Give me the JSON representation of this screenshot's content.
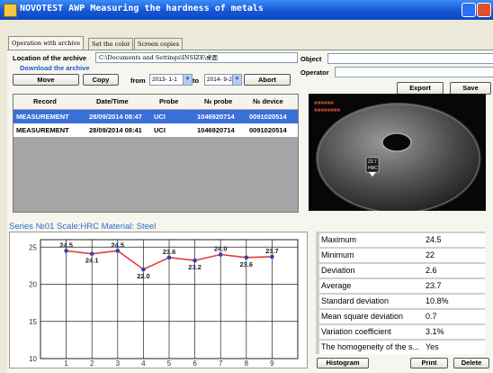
{
  "window": {
    "title": "NOVOTEST AWP Measuring the hardness of metals",
    "colors": {
      "titlebar": "#1457d6",
      "selection": "#3b6fd8",
      "series_label": "#2f6ec8",
      "chart_line": "#e23b3b",
      "chart_point": "#2446b5"
    }
  },
  "tabs": [
    {
      "label": "Operation with archive",
      "active": true
    },
    {
      "label": "Set the color",
      "active": false
    },
    {
      "label": "Screen copies",
      "active": false
    }
  ],
  "archive": {
    "location_label": "Location of the archive",
    "location_value": "C:\\Documents and Settings\\INSIZE\\桌面",
    "download_link": "Download the archive",
    "move_button": "Move",
    "copy_button": "Copy",
    "from_label": "from",
    "from_value": "2013- 1-1",
    "to_label": "to",
    "to_value": "2014- 9-2",
    "abort_button": "Abort"
  },
  "object": {
    "object_label": "Object",
    "object_value": "",
    "operator_label": "Operator",
    "operator_value": "",
    "export_button": "Export",
    "save_button": "Save"
  },
  "table": {
    "columns": [
      "Record",
      "Date/Time",
      "Probe",
      "№ probe",
      "№ device"
    ],
    "rows": [
      {
        "record": "MEASUREMENT",
        "datetime": "28/09/2014 08:47",
        "probe": "UCI",
        "probe_no": "1046920714",
        "device_no": "0091020514",
        "selected": true
      },
      {
        "record": "MEASUREMENT",
        "datetime": "28/09/2014 08:41",
        "probe": "UCI",
        "probe_no": "1046920714",
        "device_no": "0091020514",
        "selected": false
      }
    ]
  },
  "image": {
    "indicator_label": "23.7\nHRC"
  },
  "series_label": "Series №01 Scale:HRC Material: Steel",
  "chart_data": {
    "type": "line",
    "x": [
      1,
      2,
      3,
      4,
      5,
      6,
      7,
      8,
      9
    ],
    "values": [
      24.5,
      24.1,
      24.5,
      22.0,
      23.6,
      23.2,
      24.0,
      23.6,
      23.7
    ],
    "data_labels": [
      "24.5",
      "24.1",
      "24.5",
      "22.0",
      "23.6",
      "23.2",
      "24.0",
      "23.6",
      "23.7"
    ],
    "xticks": [
      "1",
      "2",
      "3",
      "4",
      "5",
      "6",
      "7",
      "8",
      "9"
    ],
    "yticks": [
      "10",
      "15",
      "20",
      "25"
    ],
    "xlim": [
      0,
      10
    ],
    "ylim": [
      10,
      26
    ],
    "grid": true,
    "title": "",
    "xlabel": "",
    "ylabel": ""
  },
  "stats": [
    {
      "name": "Maximum",
      "value": "24.5"
    },
    {
      "name": "Minimum",
      "value": "22"
    },
    {
      "name": "Deviation",
      "value": "2.6"
    },
    {
      "name": "Average",
      "value": "23.7"
    },
    {
      "name": "Standard deviation",
      "value": "10.8%"
    },
    {
      "name": "Mean square deviation",
      "value": "0.7"
    },
    {
      "name": "Variation coefficient",
      "value": "3.1%"
    },
    {
      "name": "The homogeneity of the s...",
      "value": "Yes"
    }
  ],
  "footer": {
    "histogram_button": "Histogram",
    "print_button": "Print",
    "delete_button": "Delete"
  }
}
